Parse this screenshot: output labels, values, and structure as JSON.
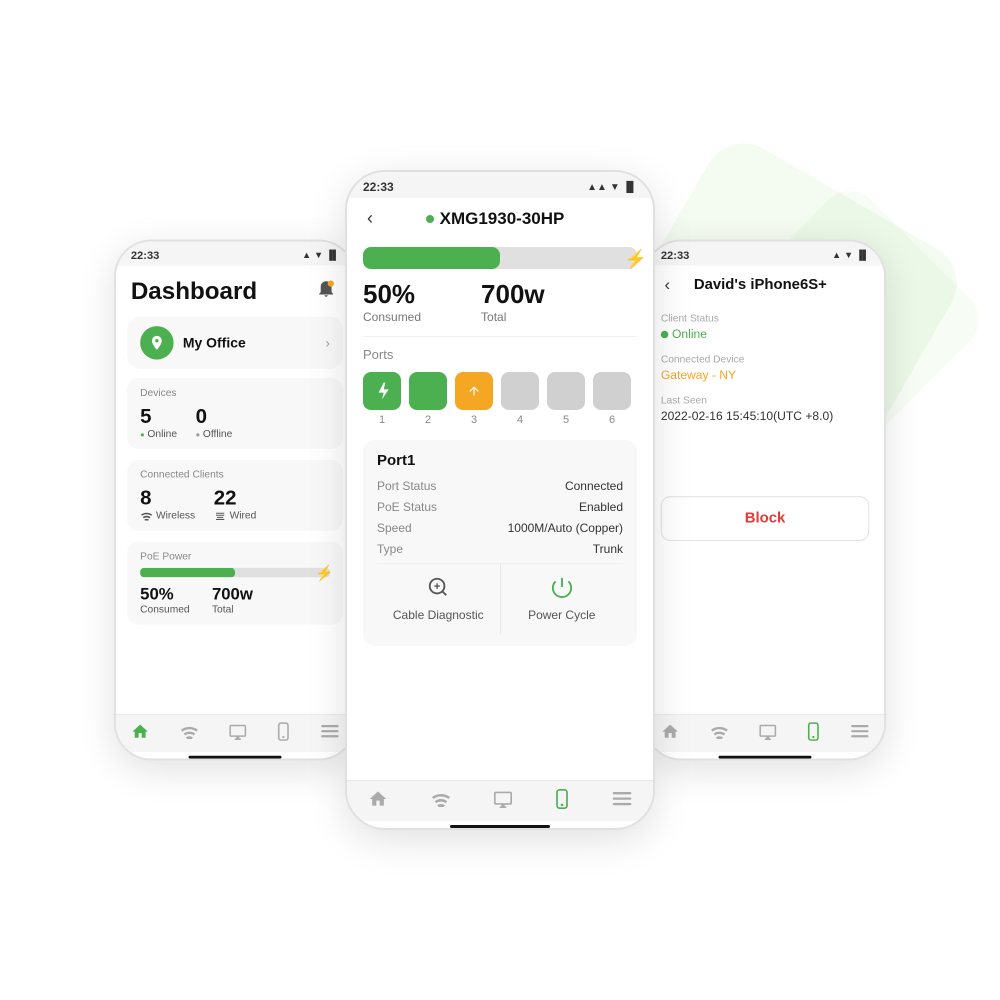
{
  "bg": {
    "color": "#ffffff"
  },
  "leftPhone": {
    "statusBar": {
      "time": "22:33",
      "icons": "▲ ▼ 🔋"
    },
    "header": {
      "title": "Dashboard",
      "bellIcon": "🔔"
    },
    "officeRow": {
      "name": "My Office",
      "chevron": "›"
    },
    "devices": {
      "label": "Devices",
      "online": {
        "count": "5",
        "label": "Online"
      },
      "offline": {
        "count": "0",
        "label": "Offline"
      }
    },
    "connectedClients": {
      "label": "Connected Clients",
      "wireless": {
        "count": "8",
        "label": "Wireless"
      },
      "wired": {
        "count": "22",
        "label": "Wired"
      }
    },
    "poe": {
      "label": "PoE Power",
      "consumed": {
        "value": "50%",
        "label": "Consumed"
      },
      "total": {
        "value": "700w",
        "label": "Total"
      },
      "percent": 50
    },
    "nav": {
      "home": "🏠",
      "wifi": "📶",
      "monitor": "🖥",
      "phone": "📱",
      "menu": "☰"
    }
  },
  "centerPhone": {
    "statusBar": {
      "time": "22:33",
      "icons": "▲ ▼ 🔋"
    },
    "header": {
      "back": "‹",
      "onlineDot": true,
      "title": "XMG1930-30HP"
    },
    "power": {
      "consumed": {
        "value": "50%",
        "label": "Consumed"
      },
      "total": {
        "value": "700w",
        "label": "Total"
      },
      "percent": 50
    },
    "ports": {
      "label": "Ports",
      "items": [
        {
          "number": "1",
          "type": "lightning",
          "color": "green"
        },
        {
          "number": "2",
          "type": "filled",
          "color": "green"
        },
        {
          "number": "3",
          "type": "up",
          "color": "orange"
        },
        {
          "number": "4",
          "type": "empty",
          "color": "gray"
        },
        {
          "number": "5",
          "type": "empty",
          "color": "gray"
        },
        {
          "number": "6",
          "type": "empty",
          "color": "gray"
        }
      ]
    },
    "portDetail": {
      "title": "Port1",
      "rows": [
        {
          "label": "Port Status",
          "value": "Connected"
        },
        {
          "label": "PoE Status",
          "value": "Enabled"
        },
        {
          "label": "Speed",
          "value": "1000M/Auto (Copper)"
        },
        {
          "label": "Type",
          "value": "Trunk"
        }
      ]
    },
    "actions": {
      "cableDiagnostic": {
        "label": "Cable Diagnostic",
        "icon": "🔍"
      },
      "powerCycle": {
        "label": "Power Cycle",
        "icon": "⏻"
      }
    },
    "nav": {
      "home": "🏠",
      "wifi": "📶",
      "monitor": "🖥",
      "phone": "📱",
      "menu": "☰"
    }
  },
  "rightPhone": {
    "statusBar": {
      "time": "22:33",
      "icons": "▲ ▼ 🔋"
    },
    "header": {
      "back": "‹",
      "title": "David's iPhone6S+"
    },
    "clientDetail": {
      "clientStatus": {
        "label": "Client Status",
        "value": "Online"
      },
      "connectedDevice": {
        "label": "Connected Device",
        "value": "Gateway - NY"
      },
      "lastSeen": {
        "label": "Last Seen",
        "value": "2022-02-16 15:45:10(UTC +8.0)"
      }
    },
    "blockBtn": "Block",
    "nav": {
      "home": "🏠",
      "wifi": "📶",
      "monitor": "🖥",
      "phone": "📱",
      "menu": "☰"
    }
  }
}
